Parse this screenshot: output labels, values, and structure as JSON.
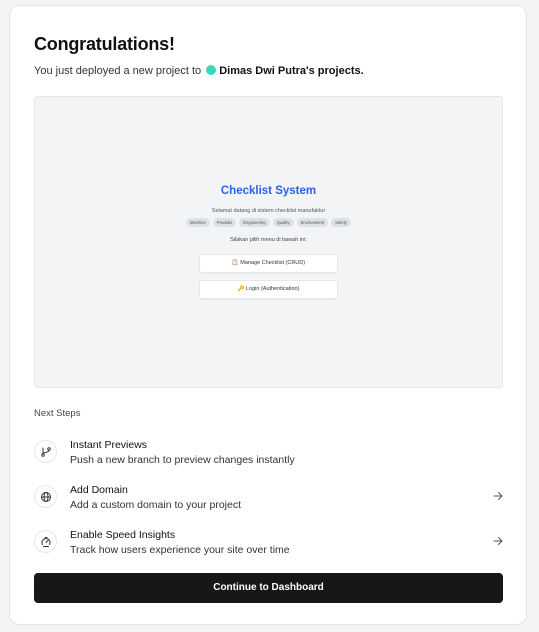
{
  "header": {
    "title": "Congratulations!",
    "subtitle_prefix": "You just deployed a new project to",
    "owner": "Dimas Dwi Putra's projects."
  },
  "preview": {
    "app_title": "Checklist System",
    "welcome": "Selamat datang di sistem checklist manufaktur",
    "tags": [
      "Machine",
      "Produks",
      "Engineering",
      "Quality",
      "Environment",
      "Safety"
    ],
    "prompt": "Silakan pilih menu di bawah ini:",
    "button_manage": "📋 Manage Checklist (CRUD)",
    "button_login": "🔑 Login (Authentication)"
  },
  "next_steps": {
    "label": "Next Steps",
    "items": [
      {
        "title": "Instant Previews",
        "desc": "Push a new branch to preview changes instantly",
        "icon": "branch-icon"
      },
      {
        "title": "Add Domain",
        "desc": "Add a custom domain to your project",
        "icon": "globe-icon"
      },
      {
        "title": "Enable Speed Insights",
        "desc": "Track how users experience your site over time",
        "icon": "speedometer-icon"
      }
    ]
  },
  "cta": {
    "label": "Continue to Dashboard"
  },
  "colors": {
    "accent_blue": "#2563eb",
    "cta_bg": "#171717"
  }
}
